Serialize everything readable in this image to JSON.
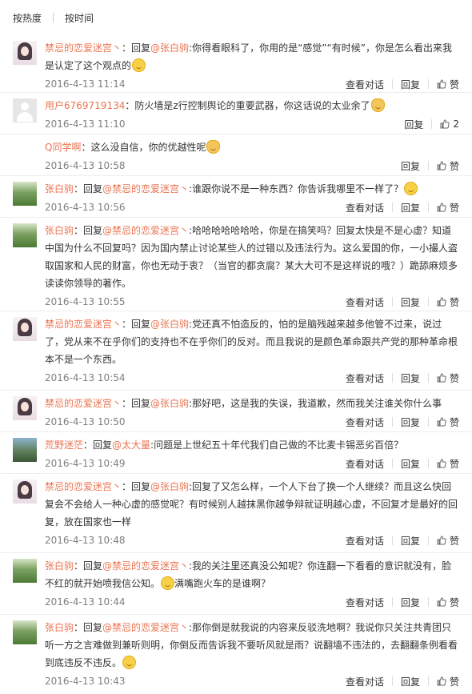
{
  "sort_bar": {
    "tab_hot": "按热度",
    "tab_time": "按时间"
  },
  "comments": [
    {
      "avatar": "girl",
      "user": "禁忌的恋爱迷宫丶",
      "pre": "：回复",
      "mention": "@张白驹",
      "text": ":你得看眼科了，你用的是“感觉”“有时候”，你是怎么看出来我是认定了这个观点的",
      "emoji": true,
      "time": "2016-4-13 11:14",
      "view": "查看对话",
      "reply": "回复",
      "like": "赞"
    },
    {
      "avatar": "default",
      "user": "用户6769719134",
      "pre": "：防火墙是z行控制舆论的重要武器，你这话说的太业余了",
      "mention": "",
      "text": "",
      "emoji": "cat",
      "time": "2016-4-13 11:10",
      "view": "",
      "reply": "回复",
      "like": "2"
    },
    {
      "avatar": "none",
      "user": "Q同学啊",
      "pre": "：这么没自信，你的优越性呢",
      "mention": "",
      "text": "",
      "emoji": "cat",
      "time": "2016-4-13 10:58",
      "view": "",
      "reply": "回复",
      "like": "赞"
    },
    {
      "avatar": "green",
      "user": "张白驹",
      "pre": "：回复",
      "mention": "@禁忌的恋爱迷宫丶",
      "text": ":谁跟你说不是一种东西？你告诉我哪里不一样了？",
      "emoji": true,
      "time": "2016-4-13 10:56",
      "view": "查看对话",
      "reply": "回复",
      "like": "赞"
    },
    {
      "avatar": "green",
      "user": "张白驹",
      "pre": "：回复",
      "mention": "@禁忌的恋爱迷宫丶",
      "text": ":哈哈哈哈哈哈哈，你是在搞笑吗？回复太快是不是心虚？知道中国为什么不回复吗？因为国内禁止讨论某些人的过错以及违法行为。这么爱国的你，一小撮人盗取国家和人民的财富，你也无动于衷？（当官的都贪腐？某大大可不是这样说的哦？）跪舔麻烦多读读你领导的著作。",
      "emoji": false,
      "time": "2016-4-13 10:55",
      "view": "查看对话",
      "reply": "回复",
      "like": "赞"
    },
    {
      "avatar": "girl",
      "user": "禁忌的恋爱迷宫丶",
      "pre": "：回复",
      "mention": "@张白驹",
      "text": ":党还真不怕造反的，怕的是脑残越来越多他管不过来，说过了，党从来不在乎你们的支持也不在乎你们的反对。而且我说的是颜色革命跟共产党的那种革命根本不是一个东西。",
      "emoji": false,
      "time": "2016-4-13 10:54",
      "view": "查看对话",
      "reply": "回复",
      "like": "赞"
    },
    {
      "avatar": "girl",
      "user": "禁忌的恋爱迷宫丶",
      "pre": "：回复",
      "mention": "@张白驹",
      "text": ":那好吧，这是我的失误，我道歉，然而我关注谁关你什么事",
      "emoji": false,
      "time": "2016-4-13 10:50",
      "view": "查看对话",
      "reply": "回复",
      "like": "赞"
    },
    {
      "avatar": "mountain",
      "user": "荒野迷茫",
      "pre": "：回复",
      "mention": "@太大量",
      "text": ":问题是上世纪五十年代我们自己做的不比麦卡锡恶劣百倍？",
      "emoji": false,
      "time": "2016-4-13 10:49",
      "view": "查看对话",
      "reply": "回复",
      "like": "赞"
    },
    {
      "avatar": "girl",
      "user": "禁忌的恋爱迷宫丶",
      "pre": "：回复",
      "mention": "@张白驹",
      "text": ":回复了又怎么样，一个人下台了换一个人继续？而且这么快回复会不会给人一种心虚的感觉呢？有时候别人越抹黑你越争辩就证明越心虚，不回复才是最好的回复，放在国家也一样",
      "emoji": false,
      "time": "2016-4-13 10:48",
      "view": "查看对话",
      "reply": "回复",
      "like": "赞"
    },
    {
      "avatar": "green",
      "user": "张白驹",
      "pre": "：回复",
      "mention": "@禁忌的恋爱迷宫丶",
      "text": ":我的关注里还真没公知呢？你连翻一下看看的意识就没有，脸不红的就开始喷我信公知。",
      "emoji": true,
      "text2": "满嘴跑火车的是谁啊？",
      "time": "2016-4-13 10:44",
      "view": "查看对话",
      "reply": "回复",
      "like": "赞"
    },
    {
      "avatar": "green",
      "user": "张白驹",
      "pre": "：回复",
      "mention": "@禁忌的恋爱迷宫丶",
      "text": ":那你倒是就我说的内容来反驳洗地啊？我说你只关注共青团只听一方之言难做到兼听则明，你倒反而告诉我不要听风就是雨？说翻墙不违法的，去翻翻条例看看到底违反不违反。",
      "emoji": true,
      "time": "2016-4-13 10:43",
      "view": "查看对话",
      "reply": "回复",
      "like": "赞"
    }
  ]
}
